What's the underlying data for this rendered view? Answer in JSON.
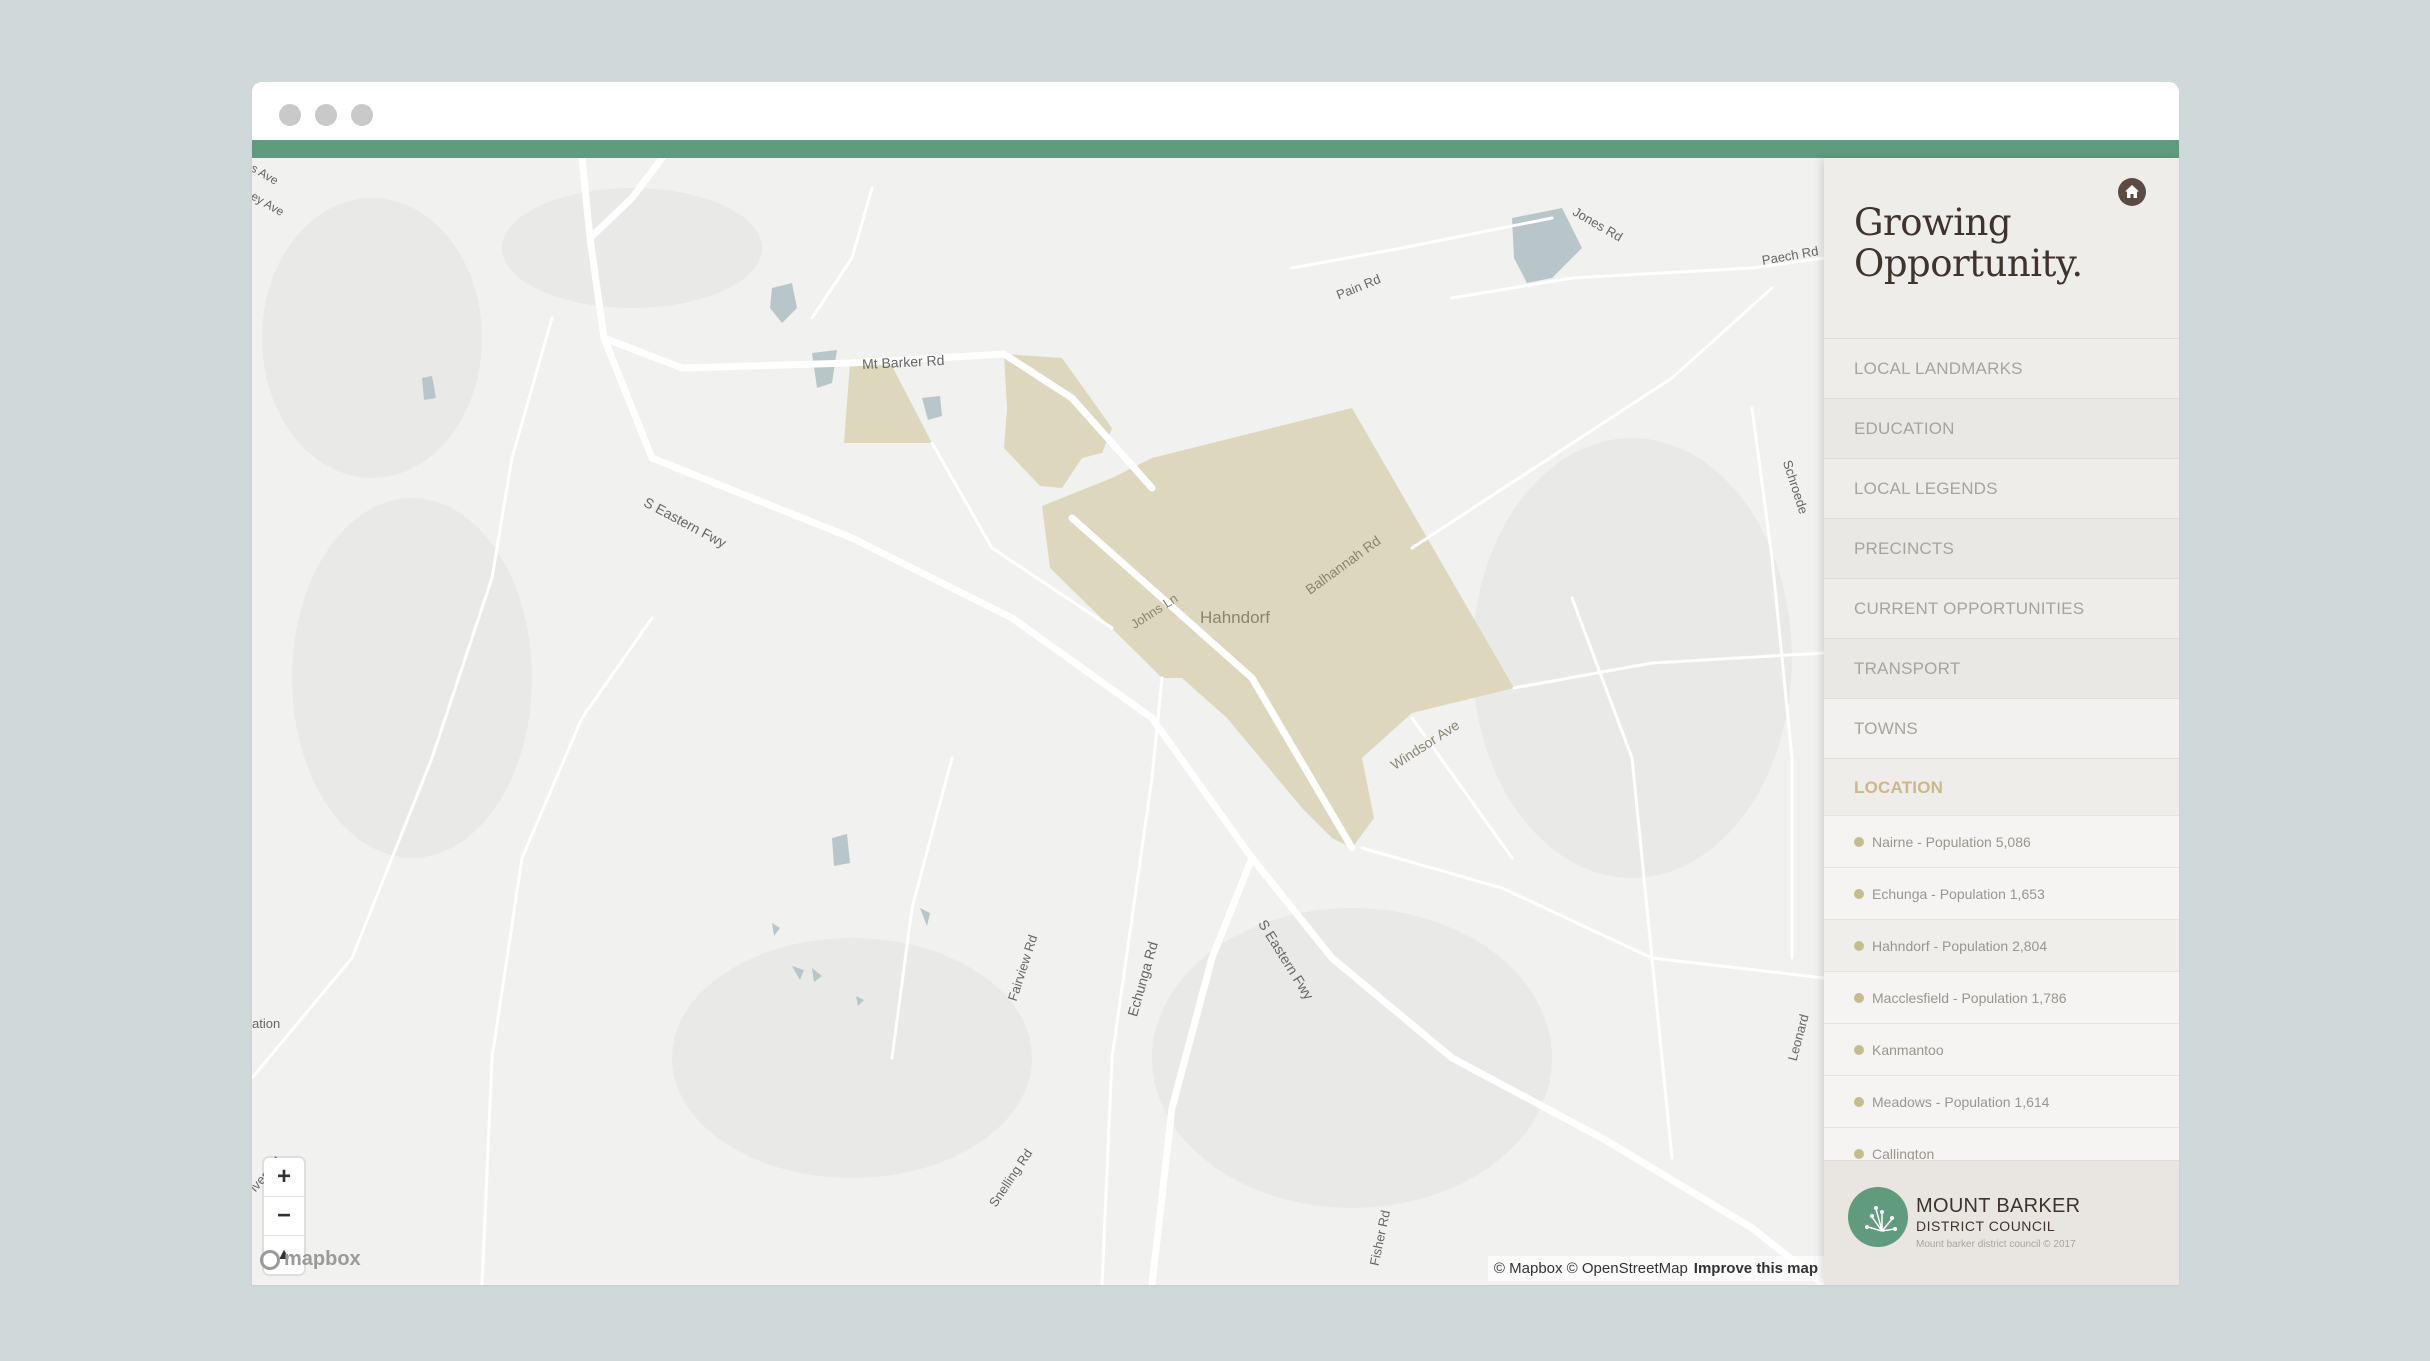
{
  "sidebar": {
    "heading_line1": "Growing",
    "heading_line2": "Opportunity.",
    "menu": [
      {
        "label": "LOCAL LANDMARKS"
      },
      {
        "label": "EDUCATION"
      },
      {
        "label": "LOCAL LEGENDS"
      },
      {
        "label": "PRECINCTS"
      },
      {
        "label": "CURRENT OPPORTUNITIES"
      },
      {
        "label": "TRANSPORT"
      },
      {
        "label": "TOWNS"
      },
      {
        "label": "LOCATION"
      }
    ],
    "locations": [
      {
        "label": "Nairne - Population 5,086"
      },
      {
        "label": "Echunga - Population 1,653"
      },
      {
        "label": "Hahndorf - Population 2,804"
      },
      {
        "label": "Macclesfield - Population 1,786"
      },
      {
        "label": "Kanmantoo"
      },
      {
        "label": "Meadows - Population 1,614"
      },
      {
        "label": "Callington"
      }
    ],
    "logo": {
      "title": "MOUNT BARKER",
      "subtitle": "DISTRICT COUNCIL",
      "copyright": "Mount barker district council © 2017"
    }
  },
  "map": {
    "labels": {
      "mt_barker_rd": "Mt Barker Rd",
      "s_eastern_fwy_1": "S Eastern Fwy",
      "s_eastern_fwy_2": "S Eastern Fwy",
      "balhannah_rd": "Balhannah Rd",
      "johns_ln": "Johns Ln",
      "hahndorf": "Hahndorf",
      "windsor_ave": "Windsor Ave",
      "echunga_rd": "Echunga Rd",
      "fairview_rd": "Fairview Rd",
      "snelling_rd": "Snelling Rd",
      "fisher_rd": "Fisher Rd",
      "pain_rd": "Pain Rd",
      "jones_rd": "Jones Rd",
      "paech_rd": "Paech Rd",
      "schroeder": "Schroede",
      "leonard": "Leonard",
      "river_rd": "iver Rd",
      "ation": "ation",
      "s_ave": "s Ave",
      "ey_ave": "ey Ave"
    },
    "zoom_in": "+",
    "zoom_out": "−",
    "compass": "▲",
    "logo_text": "mapbox",
    "attribution": "© Mapbox © OpenStreetMap",
    "improve": "Improve this map"
  },
  "colors": {
    "accent": "#5f9b7c",
    "town_fill": "#ddd8bd",
    "water": "#b8c6c9"
  }
}
